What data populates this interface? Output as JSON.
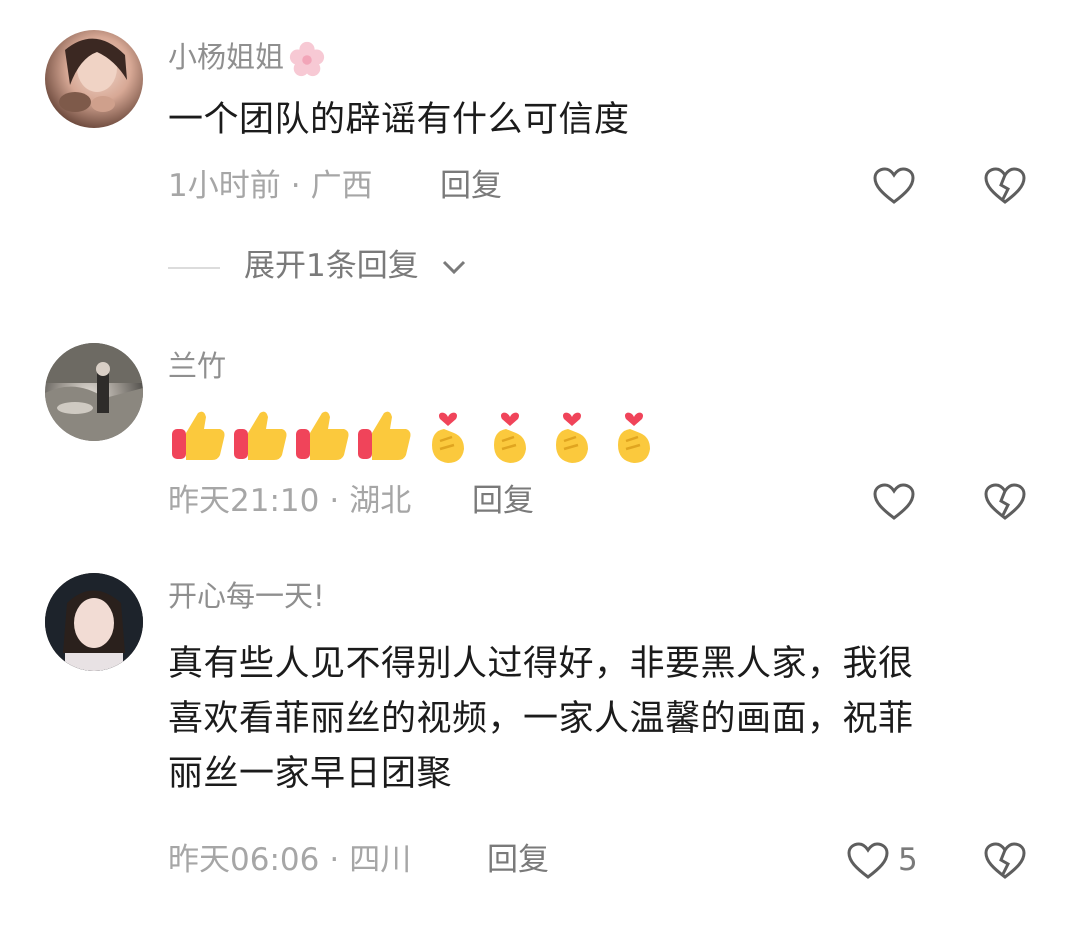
{
  "comments": [
    {
      "username": "小杨姐姐",
      "text": "一个团队的辟谣有什么可信度",
      "time": "1小时前",
      "location": "广西",
      "reply_label": "回复",
      "expand_label": "展开1条回复",
      "username_badge_icon": "sakura-flower-icon"
    },
    {
      "username": "兰竹",
      "emojis": [
        "thumbs-up",
        "thumbs-up",
        "thumbs-up",
        "thumbs-up",
        "finger-heart",
        "finger-heart",
        "finger-heart",
        "finger-heart"
      ],
      "time": "昨天21:10",
      "location": "湖北",
      "reply_label": "回复"
    },
    {
      "username": "开心每一天!",
      "text_lines": [
        "真有些人见不得别人过得好，非要黑人家，我很",
        "喜欢看菲丽丝的视频，一家人温馨的画面，祝菲",
        "丽丝一家早日团聚"
      ],
      "time": "昨天06:06",
      "location": "四川",
      "reply_label": "回复",
      "like_count": "5"
    }
  ],
  "separator": "·",
  "colors": {
    "username": "#8f8f8f",
    "meta": "#a6a6a6",
    "text": "#1b1b1b",
    "action": "#7a7a7a"
  }
}
